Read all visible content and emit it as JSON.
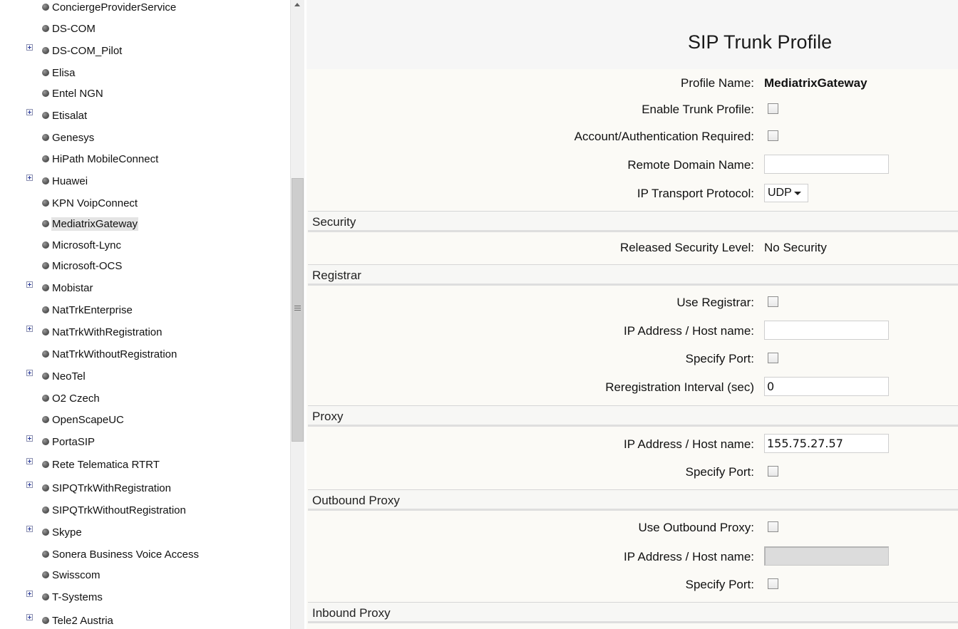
{
  "tree": {
    "items": [
      {
        "label": "ConciergeProviderService",
        "expandable": false
      },
      {
        "label": "DS-COM",
        "expandable": false
      },
      {
        "label": "DS-COM_Pilot",
        "expandable": true
      },
      {
        "label": "Elisa",
        "expandable": false
      },
      {
        "label": "Entel NGN",
        "expandable": false
      },
      {
        "label": "Etisalat",
        "expandable": true
      },
      {
        "label": "Genesys",
        "expandable": false
      },
      {
        "label": "HiPath MobileConnect",
        "expandable": false
      },
      {
        "label": "Huawei",
        "expandable": true
      },
      {
        "label": "KPN VoipConnect",
        "expandable": false
      },
      {
        "label": "MediatrixGateway",
        "expandable": false,
        "selected": true
      },
      {
        "label": "Microsoft-Lync",
        "expandable": false
      },
      {
        "label": "Microsoft-OCS",
        "expandable": false
      },
      {
        "label": "Mobistar",
        "expandable": true
      },
      {
        "label": "NatTrkEnterprise",
        "expandable": false
      },
      {
        "label": "NatTrkWithRegistration",
        "expandable": true
      },
      {
        "label": "NatTrkWithoutRegistration",
        "expandable": false
      },
      {
        "label": "NeoTel",
        "expandable": true
      },
      {
        "label": "O2 Czech",
        "expandable": false
      },
      {
        "label": "OpenScapeUC",
        "expandable": false
      },
      {
        "label": "PortaSIP",
        "expandable": true
      },
      {
        "label": "Rete Telematica RTRT",
        "expandable": true
      },
      {
        "label": "SIPQTrkWithRegistration",
        "expandable": true
      },
      {
        "label": "SIPQTrkWithoutRegistration",
        "expandable": false
      },
      {
        "label": "Skype",
        "expandable": true
      },
      {
        "label": "Sonera Business Voice Access",
        "expandable": false
      },
      {
        "label": "Swisscom",
        "expandable": false
      },
      {
        "label": "T-Systems",
        "expandable": true
      },
      {
        "label": "Tele2 Austria",
        "expandable": true
      }
    ]
  },
  "main": {
    "title": "SIP Trunk Profile",
    "profile": {
      "profile_name_label": "Profile Name:",
      "profile_name_value": "MediatrixGateway",
      "enable_label": "Enable Trunk Profile:",
      "enable_checked": false,
      "auth_label": "Account/Authentication Required:",
      "auth_checked": false,
      "remote_domain_label": "Remote Domain Name:",
      "remote_domain_value": "",
      "transport_label": "IP Transport Protocol:",
      "transport_value": "UDP"
    },
    "security": {
      "section_title": "Security",
      "level_label": "Released Security Level:",
      "level_value": "No Security"
    },
    "registrar": {
      "section_title": "Registrar",
      "use_label": "Use Registrar:",
      "use_checked": false,
      "host_label": "IP Address / Host name:",
      "host_value": "",
      "port_label": "Specify Port:",
      "port_checked": false,
      "interval_label": "Reregistration Interval (sec)",
      "interval_value": "0"
    },
    "proxy": {
      "section_title": "Proxy",
      "host_label": "IP Address / Host name:",
      "host_value": "155.75.27.57",
      "port_label": "Specify Port:",
      "port_checked": false
    },
    "outbound_proxy": {
      "section_title": "Outbound Proxy",
      "use_label": "Use Outbound Proxy:",
      "use_checked": false,
      "host_label": "IP Address / Host name:",
      "host_value": "",
      "port_label": "Specify Port:",
      "port_checked": false
    },
    "inbound_proxy": {
      "section_title": "Inbound Proxy"
    }
  }
}
